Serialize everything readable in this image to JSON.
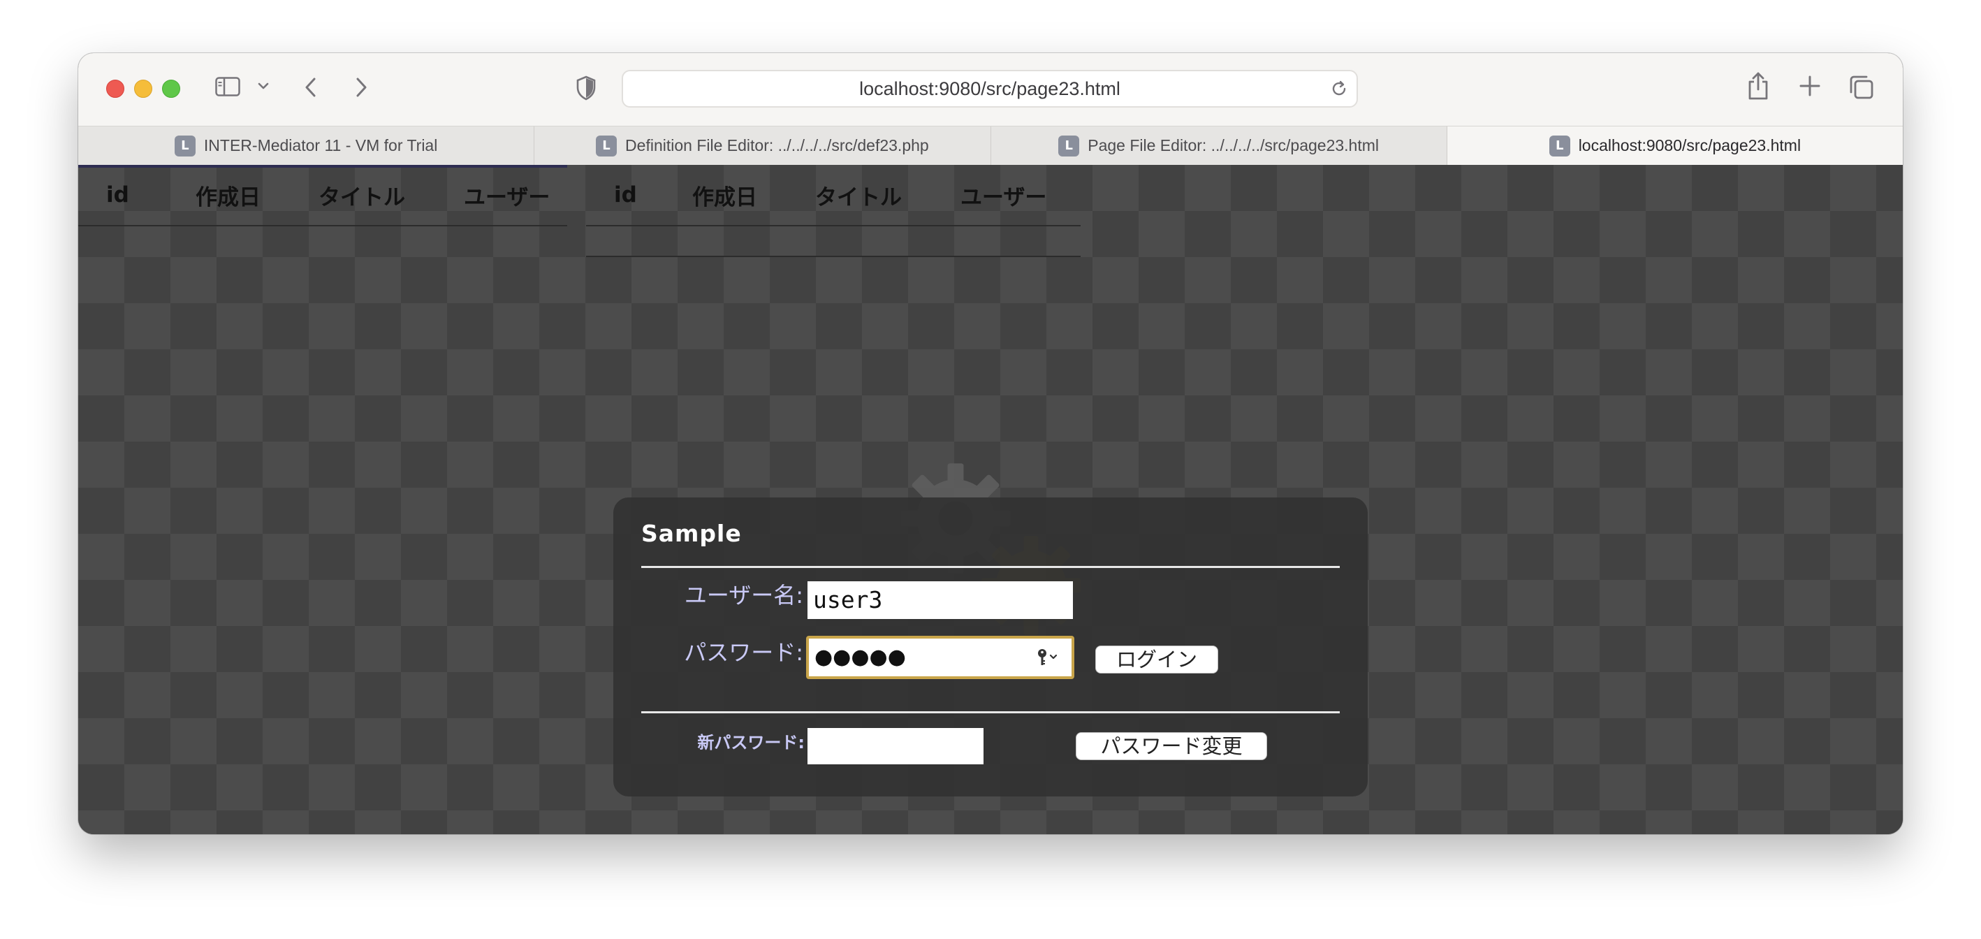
{
  "browser": {
    "address": "localhost:9080/src/page23.html",
    "tabs": [
      {
        "favicon": "L",
        "title": "INTER-Mediator 11 - VM for Trial",
        "active": false
      },
      {
        "favicon": "L",
        "title": "Definition File Editor: ../../../../src/def23.php",
        "active": false
      },
      {
        "favicon": "L",
        "title": "Page File Editor: ../../../../src/page23.html",
        "active": false
      },
      {
        "favicon": "L",
        "title": "localhost:9080/src/page23.html",
        "active": true
      }
    ],
    "icons": [
      "sidebar-icon",
      "chevron-down-icon",
      "back-icon",
      "forward-icon",
      "shield-icon",
      "reload-icon",
      "share-icon",
      "plus-icon",
      "tabs-overview-icon"
    ]
  },
  "tables": [
    {
      "headers": [
        "id",
        "作成日",
        "タイトル",
        "ユーザー"
      ]
    },
    {
      "headers": [
        "id",
        "作成日",
        "タイトル",
        "ユーザー"
      ]
    }
  ],
  "login": {
    "title": "Sample",
    "username_label": "ユーザー名:",
    "username_value": "user3",
    "password_label": "パスワード:",
    "password_masked": "●●●●●",
    "login_button": "ログイン",
    "new_password_label": "新パスワード:",
    "new_password_value": "",
    "change_password_button": "パスワード変更"
  },
  "colors": {
    "page_bg": "#4b4b4b",
    "dialog_bg": "#323232",
    "label": "#c9c9f6",
    "focus_ring": "#c9a54a"
  }
}
